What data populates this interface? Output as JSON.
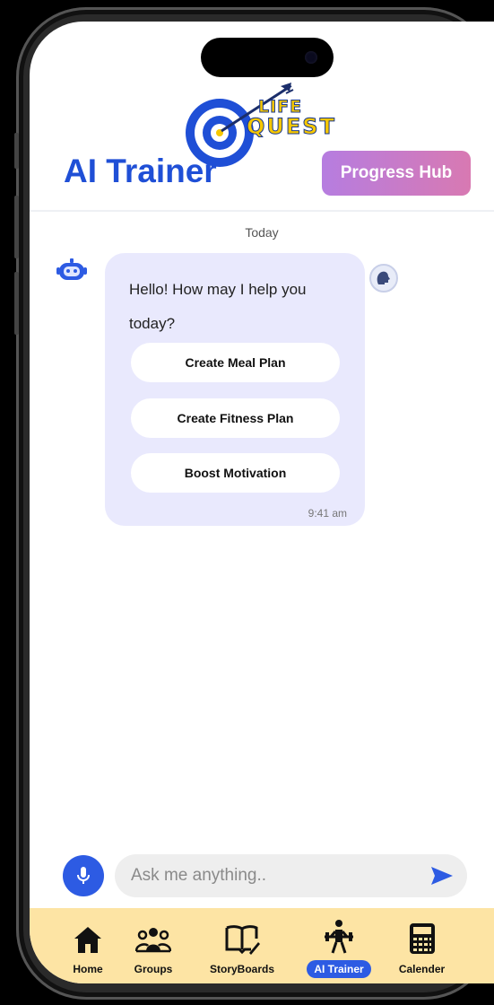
{
  "header": {
    "logo_line1": "LIFE",
    "logo_line2": "QUEST",
    "title": "AI Trainer",
    "progress_hub_label": "Progress Hub"
  },
  "chat": {
    "date_label": "Today",
    "message": "Hello! How may I help you today?",
    "quick_actions": [
      "Create Meal Plan",
      "Create Fitness Plan",
      "Boost Motivation"
    ],
    "time": "9:41 am"
  },
  "composer": {
    "placeholder": "Ask me anything.."
  },
  "nav": {
    "items": [
      {
        "label": "Home",
        "icon": "home-icon"
      },
      {
        "label": "Groups",
        "icon": "groups-icon"
      },
      {
        "label": "StoryBoards",
        "icon": "book-edit-icon"
      },
      {
        "label": "AI Trainer",
        "icon": "weightlifter-icon"
      },
      {
        "label": "Calender",
        "icon": "calculator-icon"
      }
    ],
    "active": "AI Trainer"
  },
  "colors": {
    "brand_blue": "#1f4fd6",
    "nav_active": "#2d5be3",
    "nav_background": "#fde4a4",
    "bubble_background": "#e9e9fd",
    "progress_gradient_start": "#b67de0",
    "progress_gradient_end": "#d879b2"
  }
}
